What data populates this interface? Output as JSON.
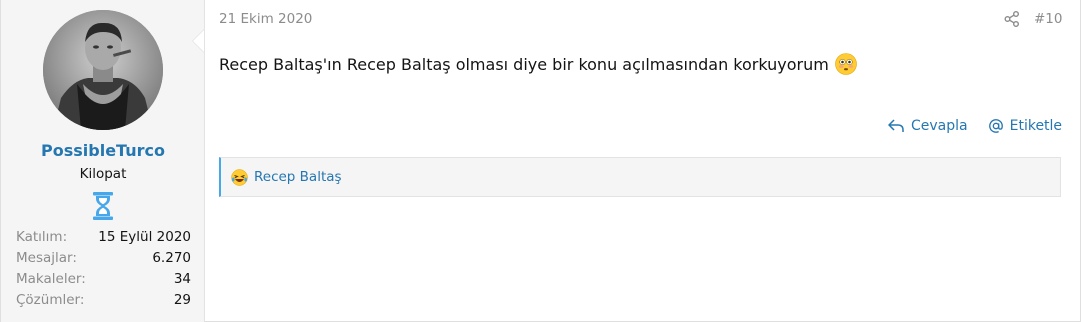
{
  "user": {
    "name": "PossibleTurco",
    "title": "Kilopat",
    "stats": [
      {
        "label": "Katılım:",
        "value": "15 Eylül 2020"
      },
      {
        "label": "Mesajlar:",
        "value": "6.270"
      },
      {
        "label": "Makaleler:",
        "value": "34"
      },
      {
        "label": "Çözümler:",
        "value": "29"
      }
    ]
  },
  "post": {
    "date": "21 Ekim 2020",
    "number": "#10",
    "body": "Recep Baltaş'ın Recep Baltaş olması diye bir konu açılmasından korkuyorum"
  },
  "actions": {
    "reply": "Cevapla",
    "tag": "Etiketle"
  },
  "reactions": {
    "text": "Recep Baltaş"
  },
  "colors": {
    "link": "#2577b1",
    "accent": "#47a7eb",
    "banner": "#47a7eb"
  }
}
